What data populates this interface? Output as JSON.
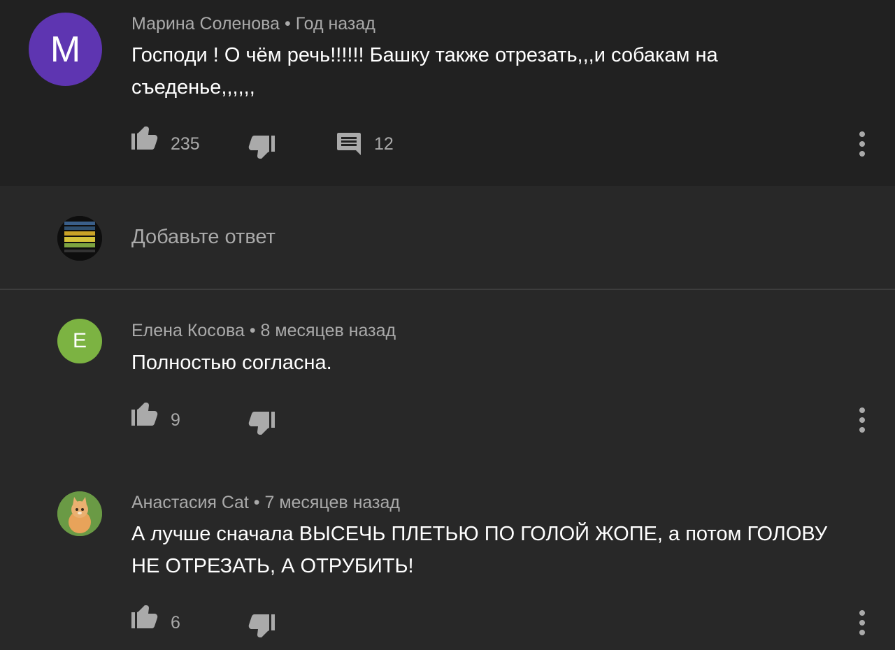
{
  "comments": [
    {
      "avatar_letter": "М",
      "author": "Марина Соленова",
      "time": "Год назад",
      "text": "Господи ! О чём речь!!!!!! Башку также отрезать,,,и собакам на съеденье,,,,,,",
      "likes": "235",
      "replies": "12",
      "avatar_color": "#5e35b1"
    },
    {
      "avatar_letter": "E",
      "author": "Елена Косова",
      "time": "8 месяцев назад",
      "text": "Полностью согласна.",
      "likes": "9",
      "avatar_color": "#7cb342"
    },
    {
      "author": "Анастасия Cat",
      "time": "7 месяцев назад",
      "text": "А лучше сначала ВЫСЕЧЬ ПЛЕТЬЮ ПО ГОЛОЙ ЖОПЕ, а потом ГОЛОВУ НЕ ОТРЕЗАТЬ, А ОТРУБИТЬ!",
      "likes": "6"
    }
  ],
  "reply": {
    "placeholder": "Добавьте ответ"
  },
  "separator": " • ",
  "icons": {
    "like": "thumb-up-icon",
    "dislike": "thumb-down-icon",
    "reply": "comment-icon",
    "more": "more-vert-icon"
  },
  "colors": {
    "top_background": "#212121",
    "background": "#282828",
    "secondary_text": "#aaaaaa"
  }
}
